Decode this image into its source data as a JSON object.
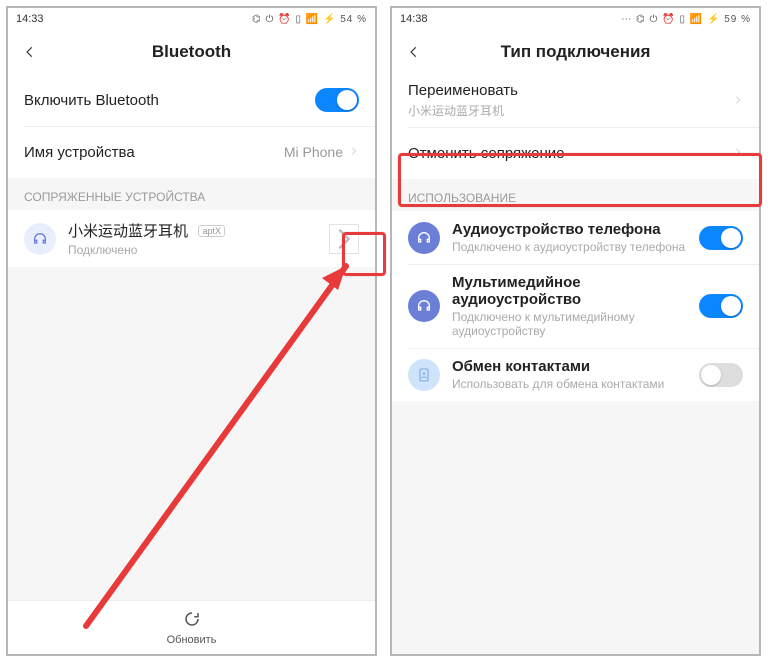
{
  "colors": {
    "accent": "#0b86ff",
    "danger": "#e83a3a"
  },
  "left": {
    "status": {
      "time": "14:33",
      "battery_text": "54 %"
    },
    "header": {
      "title": "Bluetooth"
    },
    "rows": {
      "enable_label": "Включить Bluetooth",
      "device_name_label": "Имя устройства",
      "device_name_value": "Mi Phone"
    },
    "section_paired": "СОПРЯЖЕННЫЕ УСТРОЙСТВА",
    "device": {
      "name": "小米运动蓝牙耳机",
      "codec_badge": "aptX",
      "status": "Подключено"
    },
    "bottom": {
      "refresh": "Обновить"
    }
  },
  "right": {
    "status": {
      "time": "14:38",
      "battery_text": "59 %"
    },
    "header": {
      "title": "Тип подключения"
    },
    "rows": {
      "rename_label": "Переименовать",
      "rename_sub": "小米运动蓝牙耳机",
      "unpair_label": "Отменить сопряжение"
    },
    "section_usage": "ИСПОЛЬЗОВАНИЕ",
    "usage": {
      "phone_audio": {
        "title": "Аудиоустройство телефона",
        "sub": "Подключено к аудиоустройству телефона"
      },
      "media_audio": {
        "title": "Мультимедийное аудиоустройство",
        "sub": "Подключено к мультимедийному аудиоустройству"
      },
      "contacts": {
        "title": "Обмен контактами",
        "sub": "Использовать для обмена контактами"
      }
    }
  }
}
